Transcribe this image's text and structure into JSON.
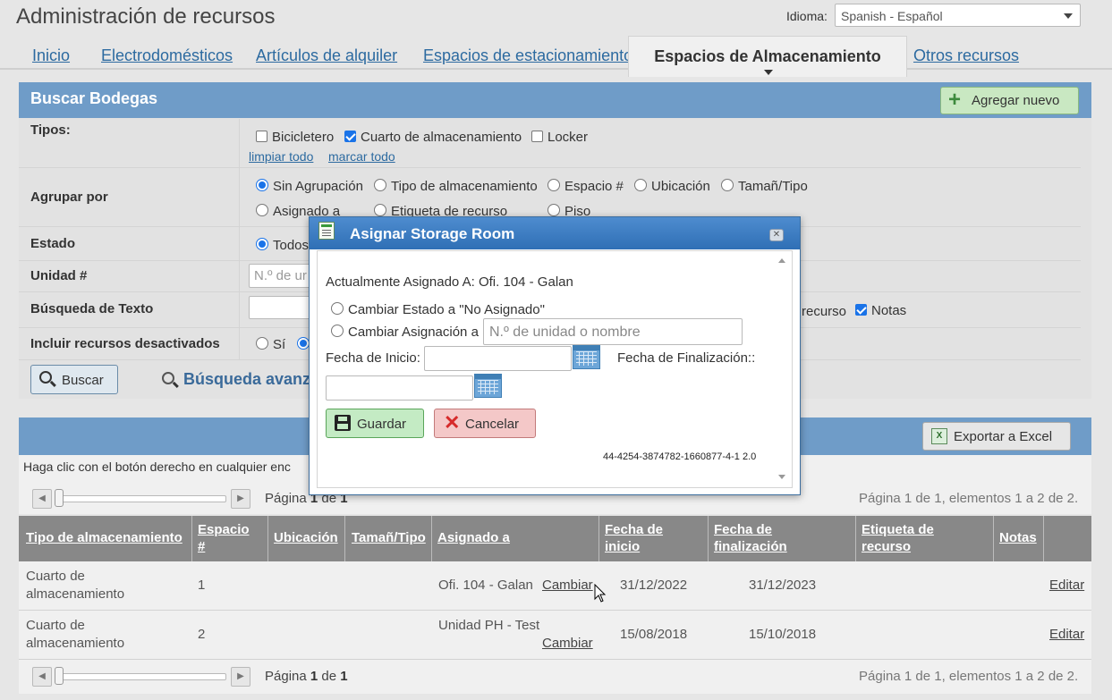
{
  "app": {
    "title": "Administración de recursos",
    "language_label": "Idioma:",
    "language_value": "Spanish - Español"
  },
  "nav": {
    "tabs": [
      "Inicio",
      "Electrodomésticos",
      "Artículos de alquiler",
      "Espacios de estacionamiento",
      "Espacios de Almacenamiento",
      "Otros recursos"
    ],
    "active_index": 4
  },
  "search": {
    "title": "Buscar Bodegas",
    "add_label": "Agregar nuevo",
    "types_label": "Tipos:",
    "types": [
      {
        "label": "Bicicletero",
        "checked": false
      },
      {
        "label": "Cuarto de almacenamiento",
        "checked": true
      },
      {
        "label": "Locker",
        "checked": false
      }
    ],
    "clear_all": "limpiar todo",
    "check_all": "marcar todo",
    "group_label": "Agrupar por",
    "group_options": [
      "Sin Agrupación",
      "Tipo de almacenamiento",
      "Espacio #",
      "Ubicación",
      "Tamañ/Tipo",
      "Asignado a",
      "Etiqueta de recurso",
      "Piso"
    ],
    "group_selected": "Sin Agrupación",
    "status_label": "Estado",
    "status_first": "Todos",
    "unit_label": "Unidad #",
    "unit_placeholder": "N.º de ur",
    "text_label": "Búsqueda de Texto",
    "text_fields_visible": [
      "recurso",
      "Notas"
    ],
    "notes_checked": true,
    "deactivated_label": "Incluir recursos desactivados",
    "deactivated_yes": "Sí",
    "search_button": "Buscar",
    "advanced_search": "Búsqueda avanza"
  },
  "results": {
    "export_label": "Exportar a Excel",
    "hint": "Haga clic con el botón derecho en cualquier enc",
    "pager": {
      "page_word": "Página",
      "page": "1",
      "of_word": "de",
      "total_pages": "1",
      "summary": "Página 1 de 1, elementos 1 a 2 de 2."
    },
    "columns": [
      "Tipo de almacenamiento",
      "Espacio #",
      "Ubicación",
      "Tamañ/Tipo",
      "Asignado a",
      "Fecha de inicio",
      "Fecha de finalización",
      "Etiqueta de recurso",
      "Notas"
    ],
    "rows": [
      {
        "type": "Cuarto de almacenamiento",
        "space": "1",
        "location": "",
        "size": "",
        "assigned": "Ofi. 104 - Galan",
        "change": "Cambiar",
        "start": "31/12/2022",
        "end": "31/12/2023",
        "tag": "",
        "notes": "",
        "edit": "Editar"
      },
      {
        "type": "Cuarto de almacenamiento",
        "space": "2",
        "location": "",
        "size": "",
        "assigned": "Unidad PH - Test",
        "change": "Cambiar",
        "start": "15/08/2018",
        "end": "15/10/2018",
        "tag": "",
        "notes": "",
        "edit": "Editar"
      }
    ]
  },
  "dialog": {
    "title": "Asignar Storage Room",
    "current": "Actualmente Asignado A: Ofi. 104 - Galan",
    "option_unassign": "Cambiar Estado a \"No Asignado\"",
    "option_reassign": "Cambiar Asignación a",
    "reassign_placeholder": "N.º de unidad o nombre",
    "start_label": "Fecha de Inicio:",
    "end_label": "Fecha de Finalización::",
    "save": "Guardar",
    "cancel": "Cancelar",
    "footer_id": "44-4254-3874782-1660877-4-1 2.0"
  },
  "colors": {
    "header_blue": "#6f9cc8",
    "link": "#2c6aa0",
    "table_header": "#888888",
    "save_green": "#c4ebc4",
    "cancel_red": "#f4c8c8"
  }
}
